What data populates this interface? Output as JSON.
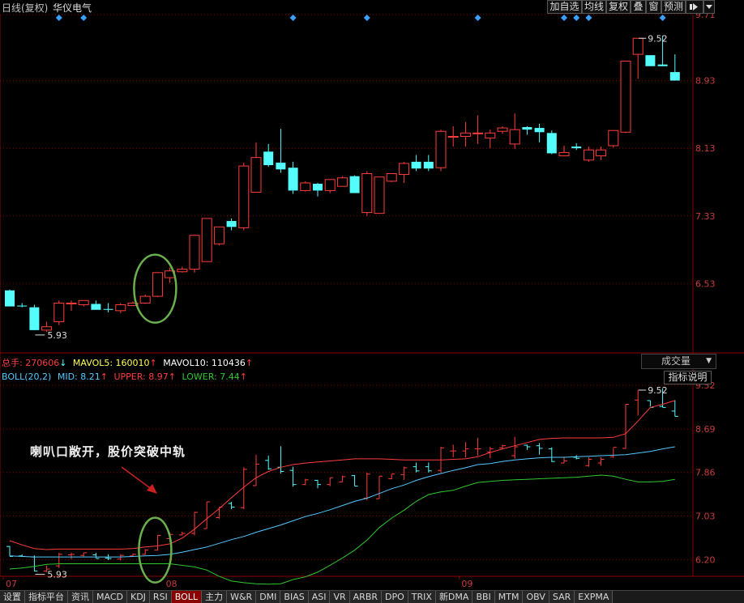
{
  "header": {
    "period_label": "日线(复权)",
    "stock_name": "华仪电气",
    "buttons": [
      "加自选",
      "均线",
      "复权",
      "叠",
      "窗",
      "预测"
    ],
    "nav_icon": "pin-icon",
    "dropdown_icon": "chevron-down-icon"
  },
  "volume_info": {
    "total_label": "总手: 270606",
    "mavol5": "MAVOL5: 160010",
    "mavol10": "MAVOL10: 110436"
  },
  "boll_info": {
    "name": "BOLL(20,2)",
    "mid": "MID: 8.21",
    "upper": "UPPER: 8.97",
    "lower": "LOWER: 7.44"
  },
  "indicator_dropdown": "成交量",
  "help_button": "指标说明",
  "annotation": "喇叭口敞开，股价突破中轨",
  "tabs": [
    "设置",
    "指标平台",
    "资讯",
    "MACD",
    "KDJ",
    "RSI",
    "BOLL",
    "主力",
    "W&R",
    "DMI",
    "BIAS",
    "ASI",
    "VR",
    "ARBR",
    "DPO",
    "TRIX",
    "新DMA",
    "BBI",
    "MTM",
    "OBV",
    "SAR",
    "EXPMA"
  ],
  "active_tab": "BOLL",
  "colors": {
    "up": "#ff3c3c",
    "down": "#54fcfc",
    "upper_band": "#ff3c3c",
    "mid_band": "#54c8ff",
    "lower_band": "#2ec82e",
    "grid": "#8b0000",
    "circle": "#6ab04c",
    "arrow": "#cc2020",
    "marker": "#3aa0ff"
  },
  "chart_data": [
    {
      "type": "candlestick",
      "x_labels": [
        "07",
        "08",
        "09"
      ],
      "y_ticks": [
        6.53,
        7.33,
        8.13,
        8.93,
        9.71
      ],
      "y_range": [
        5.73,
        9.71
      ],
      "high_annotation": "9.52",
      "low_annotation": "5.93",
      "marker_candles": [
        4,
        6,
        23,
        29,
        38,
        45,
        46,
        47,
        53
      ],
      "ohlc": [
        [
          6.45,
          6.46,
          6.27,
          6.26
        ],
        [
          6.27,
          6.3,
          6.25,
          6.26
        ],
        [
          6.25,
          6.28,
          5.98,
          5.98
        ],
        [
          5.98,
          6.08,
          5.96,
          6.02
        ],
        [
          6.08,
          6.33,
          6.04,
          6.3
        ],
        [
          6.29,
          6.33,
          6.21,
          6.3
        ],
        [
          6.28,
          6.33,
          6.26,
          6.33
        ],
        [
          6.29,
          6.33,
          6.23,
          6.22
        ],
        [
          6.23,
          6.3,
          6.19,
          6.22
        ],
        [
          6.21,
          6.3,
          6.18,
          6.28
        ],
        [
          6.27,
          6.32,
          6.27,
          6.3
        ],
        [
          6.3,
          6.4,
          6.29,
          6.38
        ],
        [
          6.38,
          6.66,
          6.37,
          6.66
        ],
        [
          6.6,
          6.72,
          6.54,
          6.68
        ],
        [
          6.67,
          6.73,
          6.66,
          6.7
        ],
        [
          6.7,
          7.11,
          6.66,
          7.1
        ],
        [
          6.79,
          7.3,
          6.79,
          7.3
        ],
        [
          7.0,
          7.19,
          6.98,
          7.2
        ],
        [
          7.27,
          7.3,
          7.16,
          7.2
        ],
        [
          7.19,
          7.96,
          7.16,
          7.92
        ],
        [
          7.61,
          8.2,
          7.61,
          8.02
        ],
        [
          8.09,
          8.18,
          7.91,
          7.93
        ],
        [
          7.96,
          8.36,
          7.84,
          7.88
        ],
        [
          7.9,
          7.97,
          7.59,
          7.63
        ],
        [
          7.63,
          7.74,
          7.62,
          7.72
        ],
        [
          7.71,
          7.72,
          7.56,
          7.63
        ],
        [
          7.63,
          7.76,
          7.6,
          7.76
        ],
        [
          7.68,
          7.8,
          7.68,
          7.78
        ],
        [
          7.8,
          7.81,
          7.6,
          7.6
        ],
        [
          7.37,
          7.86,
          7.33,
          7.83
        ],
        [
          7.36,
          7.79,
          7.36,
          7.79
        ],
        [
          7.74,
          7.83,
          7.73,
          7.83
        ],
        [
          7.82,
          7.97,
          7.72,
          7.95
        ],
        [
          7.97,
          8.05,
          7.86,
          7.89
        ],
        [
          7.97,
          8.05,
          7.86,
          7.89
        ],
        [
          7.9,
          8.35,
          7.86,
          8.33
        ],
        [
          8.27,
          8.39,
          8.15,
          8.27
        ],
        [
          8.27,
          8.44,
          8.15,
          8.31
        ],
        [
          8.31,
          8.52,
          8.18,
          8.31
        ],
        [
          8.25,
          8.35,
          8.13,
          8.31
        ],
        [
          8.33,
          8.39,
          8.3,
          8.37
        ],
        [
          8.18,
          8.54,
          8.12,
          8.35
        ],
        [
          8.38,
          8.39,
          8.29,
          8.35
        ],
        [
          8.37,
          8.42,
          8.2,
          8.32
        ],
        [
          8.31,
          8.34,
          8.06,
          8.07
        ],
        [
          8.04,
          8.16,
          8.04,
          8.08
        ],
        [
          8.15,
          8.19,
          8.11,
          8.13
        ],
        [
          7.99,
          8.15,
          7.97,
          8.11
        ],
        [
          8.04,
          8.15,
          7.99,
          8.11
        ],
        [
          8.16,
          8.33,
          8.14,
          8.34
        ],
        [
          8.32,
          9.16,
          8.31,
          9.16
        ],
        [
          9.24,
          9.43,
          8.95,
          9.43
        ],
        [
          9.23,
          9.23,
          9.12,
          9.1
        ],
        [
          9.12,
          9.46,
          9.1,
          9.1
        ],
        [
          9.03,
          9.24,
          8.93,
          8.93
        ]
      ]
    },
    {
      "type": "line",
      "indicator": "BOLL(20,2)",
      "y_ticks": [
        6.2,
        7.03,
        7.86,
        8.69,
        9.52
      ],
      "y_range": [
        5.65,
        9.8
      ],
      "x_labels": [
        "07",
        "08",
        "09"
      ],
      "high_annotation": "9.52",
      "low_annotation": "5.93",
      "series": [
        {
          "name": "UPPER",
          "values": [
            6.56,
            6.48,
            6.41,
            6.39,
            6.4,
            6.4,
            6.4,
            6.4,
            6.4,
            6.4,
            6.41,
            6.44,
            6.46,
            6.5,
            6.61,
            6.78,
            6.98,
            7.17,
            7.38,
            7.58,
            7.76,
            7.88,
            7.96,
            8.01,
            8.04,
            8.06,
            8.08,
            8.1,
            8.12,
            8.12,
            8.12,
            8.11,
            8.1,
            8.1,
            8.1,
            8.1,
            8.11,
            8.12,
            8.16,
            8.24,
            8.31,
            8.37,
            8.43,
            8.49,
            8.51,
            8.52,
            8.52,
            8.52,
            8.52,
            8.53,
            8.6,
            8.84,
            9.1,
            9.16,
            9.23
          ]
        },
        {
          "name": "MID",
          "values": [
            6.27,
            6.26,
            6.25,
            6.25,
            6.25,
            6.25,
            6.25,
            6.25,
            6.25,
            6.25,
            6.26,
            6.27,
            6.28,
            6.3,
            6.34,
            6.39,
            6.44,
            6.51,
            6.58,
            6.64,
            6.72,
            6.79,
            6.86,
            6.94,
            7.02,
            7.08,
            7.15,
            7.23,
            7.31,
            7.37,
            7.46,
            7.55,
            7.62,
            7.71,
            7.78,
            7.84,
            7.9,
            7.95,
            8.01,
            8.03,
            8.07,
            8.1,
            8.12,
            8.14,
            8.15,
            8.15,
            8.16,
            8.17,
            8.18,
            8.19,
            8.2,
            8.23,
            8.26,
            8.31,
            8.35
          ]
        },
        {
          "name": "LOWER",
          "values": [
            6.02,
            6.04,
            6.07,
            6.11,
            6.12,
            6.12,
            6.12,
            6.12,
            6.12,
            6.12,
            6.12,
            6.12,
            6.12,
            6.12,
            6.09,
            6.06,
            6.0,
            5.88,
            5.79,
            5.76,
            5.74,
            5.73,
            5.74,
            5.82,
            5.87,
            5.96,
            6.09,
            6.23,
            6.38,
            6.57,
            6.81,
            6.99,
            7.14,
            7.31,
            7.44,
            7.49,
            7.52,
            7.6,
            7.67,
            7.69,
            7.71,
            7.72,
            7.73,
            7.74,
            7.75,
            7.76,
            7.77,
            7.79,
            7.81,
            7.79,
            7.73,
            7.68,
            7.68,
            7.69,
            7.73
          ]
        }
      ]
    }
  ]
}
